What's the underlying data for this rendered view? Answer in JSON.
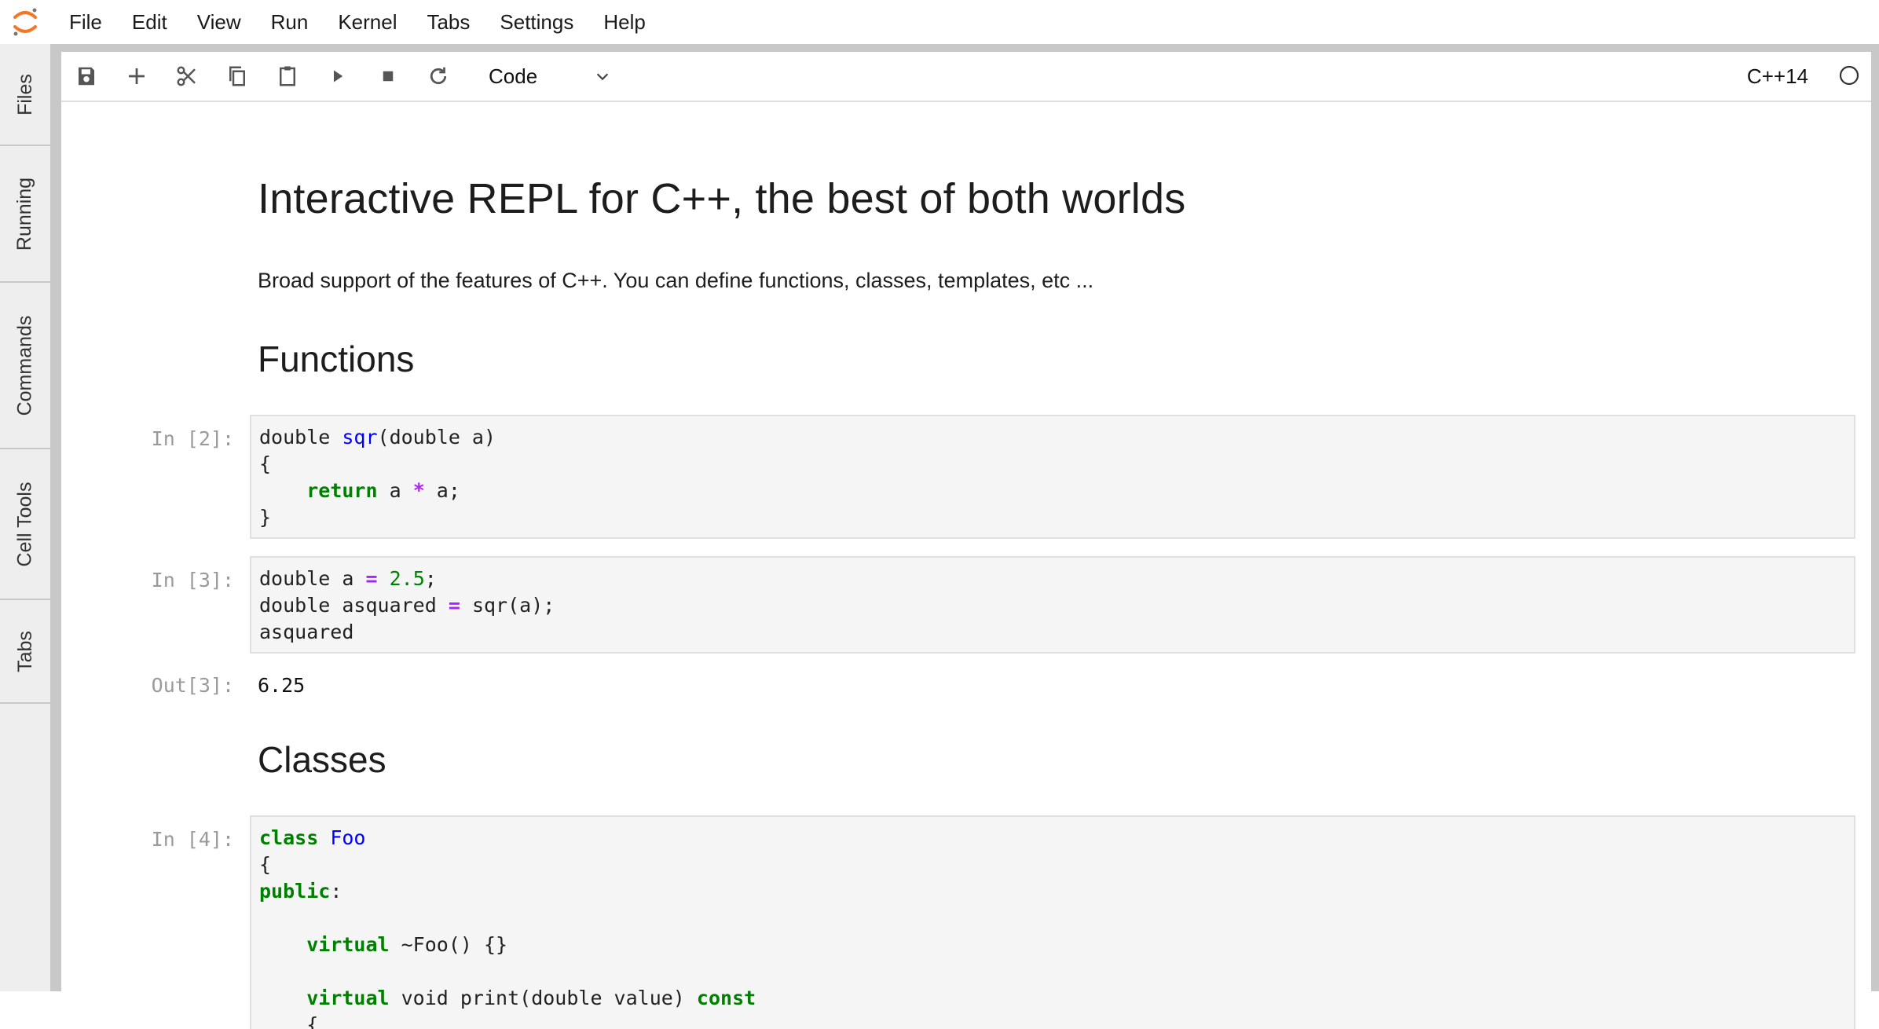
{
  "menu": {
    "items": [
      "File",
      "Edit",
      "View",
      "Run",
      "Kernel",
      "Tabs",
      "Settings",
      "Help"
    ]
  },
  "sidebar": {
    "tabs": [
      "Files",
      "Running",
      "Commands",
      "Cell Tools",
      "Tabs"
    ]
  },
  "toolbar": {
    "cell_type": "Code",
    "kernel": "C++14",
    "icons": [
      "save-icon",
      "plus-icon",
      "scissors-icon",
      "copy-icon",
      "paste-icon",
      "run-icon",
      "stop-icon",
      "restart-icon"
    ]
  },
  "notebook": {
    "title": "Interactive REPL for C++, the best of both worlds",
    "intro": "Broad support of the features of C++. You can define functions, classes, templates, etc ...",
    "section_functions": "Functions",
    "section_classes": "Classes",
    "cells": [
      {
        "prompt": "In [2]:",
        "lines": [
          "double sqr(double a)",
          "{",
          "    return a * a;",
          "}"
        ]
      },
      {
        "prompt": "In [3]:",
        "lines": [
          "double a = 2.5;",
          "double asquared = sqr(a);",
          "asquared"
        ],
        "out_prompt": "Out[3]:",
        "output": "6.25"
      },
      {
        "prompt": "In [4]:",
        "lines": [
          "class Foo",
          "{",
          "public:",
          "",
          "    virtual ~Foo() {}",
          "",
          "    virtual void print(double value) const",
          "    {"
        ]
      }
    ]
  },
  "colors": {
    "keyword": "#008000",
    "function_name": "#0000ff",
    "operator": "#aa22ff",
    "number": "#008000",
    "prompt": "#9a9a9a",
    "logo": "#f37726"
  }
}
